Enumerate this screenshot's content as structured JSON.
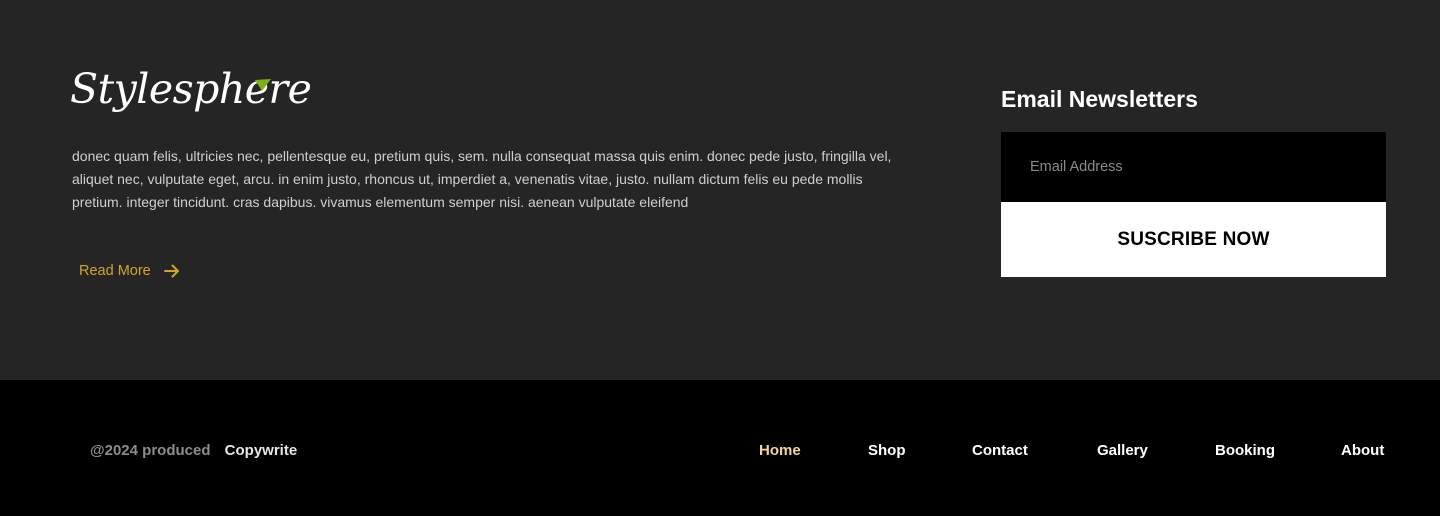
{
  "brand": {
    "logo_text": "Stylesphere",
    "leaf_color": "#7ab317"
  },
  "about": {
    "description": "donec quam felis, ultricies nec, pellentesque eu, pretium quis, sem. nulla consequat massa quis enim. donec pede justo, fringilla vel, aliquet nec, vulputate eget, arcu. in enim justo, rhoncus ut, imperdiet a, venenatis vitae, justo. nullam dictum felis eu pede mollis pretium. integer tincidunt. cras dapibus. vivamus elementum semper nisi. aenean vulputate eleifend",
    "read_more_label": "Read More",
    "read_more_icon": "arrow-right-icon",
    "accent_color": "#d6a22a"
  },
  "newsletter": {
    "title": "Email Newsletters",
    "email_placeholder": "Email Address",
    "email_value": "",
    "subscribe_label": "SUSCRIBE NOW"
  },
  "footer": {
    "copyright_prefix": "@2024 produced",
    "copyright_link": "Copywrite",
    "nav": [
      {
        "label": "Home",
        "active": true
      },
      {
        "label": "Shop",
        "active": false
      },
      {
        "label": "Contact",
        "active": false
      },
      {
        "label": "Gallery",
        "active": false
      },
      {
        "label": "Booking",
        "active": false
      },
      {
        "label": "About",
        "active": false
      }
    ],
    "active_color": "#f2d49a"
  }
}
